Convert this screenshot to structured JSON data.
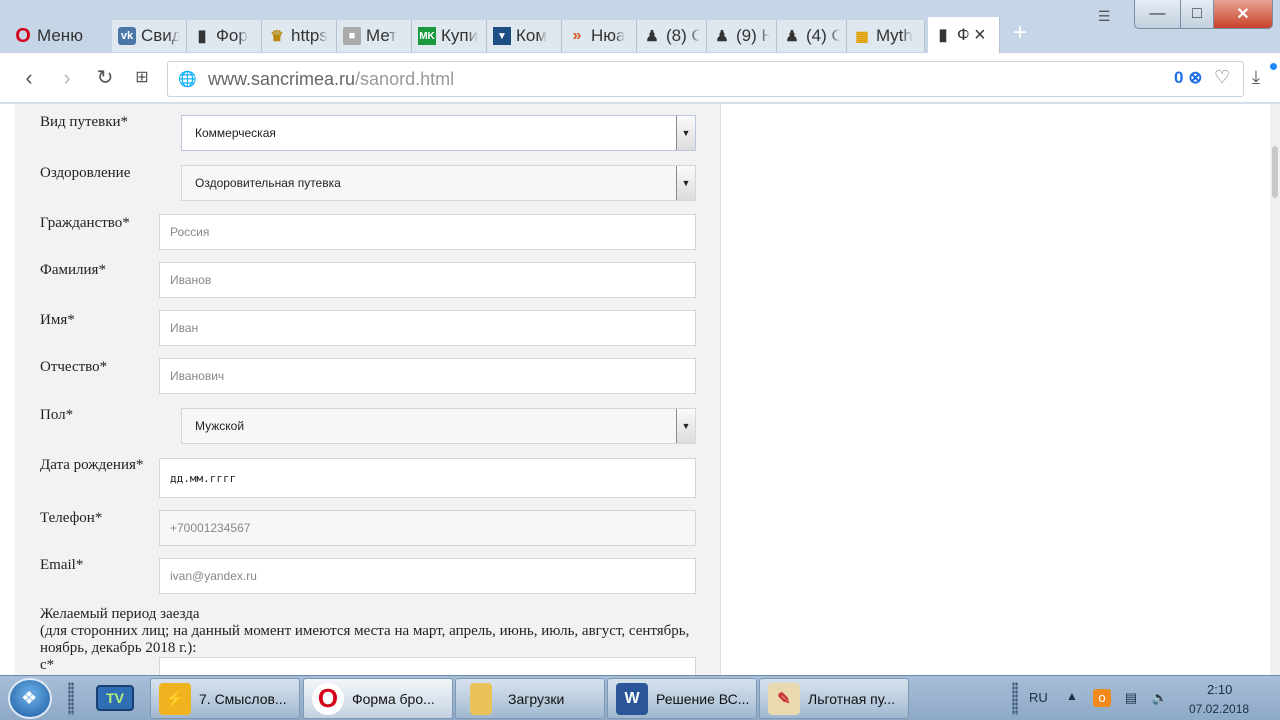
{
  "browser": {
    "menu_label": "Меню",
    "tabs": [
      {
        "title": "Свид",
        "icon": "vk-icon"
      },
      {
        "title": "Фор",
        "icon": "document-icon"
      },
      {
        "title": "https",
        "icon": "emblem-icon"
      },
      {
        "title": "Мет",
        "icon": "puzzle-icon"
      },
      {
        "title": "Купи",
        "icon": "mk-icon"
      },
      {
        "title": "Ком",
        "icon": "bookmark-icon"
      },
      {
        "title": "Нюа",
        "icon": "chevrons-icon"
      },
      {
        "title": "(8) С",
        "icon": "officer-icon"
      },
      {
        "title": "(9) Н",
        "icon": "officer-icon"
      },
      {
        "title": "(4) С",
        "icon": "officer-icon"
      },
      {
        "title": "Myth",
        "icon": "grid-icon"
      },
      {
        "title": "Ф",
        "icon": "document-icon",
        "active": true
      }
    ],
    "url_host": "www.sancrimea.ru",
    "url_path": "/sanord.html",
    "adblock_count": "0",
    "accent": "#1e6ee6"
  },
  "form": {
    "voucher_type": {
      "label": "Вид путевки*",
      "value": "Коммерческая"
    },
    "health": {
      "label": "Оздоровление",
      "value": "Оздоровительная путевка"
    },
    "citizenship": {
      "label": "Гражданство*",
      "placeholder": "Россия"
    },
    "surname": {
      "label": "Фамилия*",
      "placeholder": "Иванов"
    },
    "name": {
      "label": "Имя*",
      "placeholder": "Иван"
    },
    "patronymic": {
      "label": "Отчество*",
      "placeholder": "Иванович"
    },
    "gender": {
      "label": "Пол*",
      "value": "Мужской"
    },
    "birthdate": {
      "label": "Дата рождения*",
      "placeholder": "дд.мм.гггг"
    },
    "phone": {
      "label": "Телефон*",
      "placeholder": "+70001234567"
    },
    "email": {
      "label": "Email*",
      "placeholder": "ivan@yandex.ru"
    },
    "period": {
      "line1": "Желаемый период заезда",
      "line2": "(для сторонних лиц; на данный момент имеются места на март, апрель, июнь, июль, август, сентябрь, ноябрь, декабрь 2018 г.):",
      "from_label": "с*"
    }
  },
  "taskbar": {
    "tasks": [
      {
        "label": "7. Смыслов...",
        "icon": "winamp-icon"
      },
      {
        "label": "Форма бро...",
        "icon": "opera-icon",
        "active": true
      },
      {
        "label": "Загрузки",
        "icon": "folder-icon"
      },
      {
        "label": "Решение ВС...",
        "icon": "word-icon"
      },
      {
        "label": "Льготная пу...",
        "icon": "paint-icon"
      }
    ],
    "lang": "RU",
    "time": "2:10",
    "date": "07.02.2018"
  }
}
